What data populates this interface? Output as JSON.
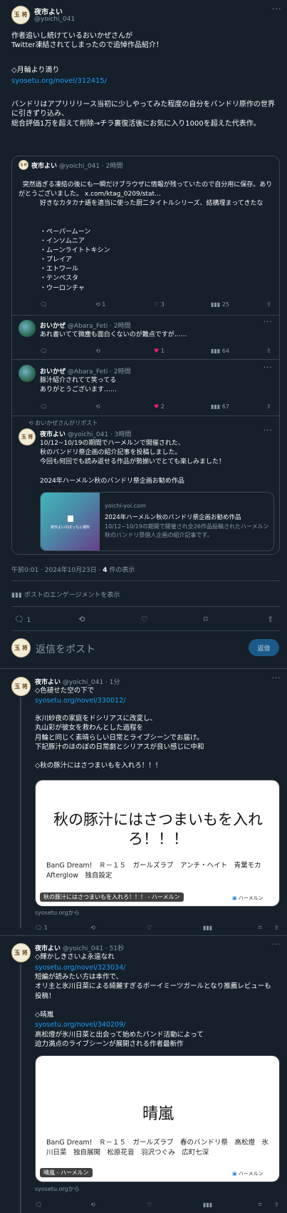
{
  "main": {
    "name": "夜市よい",
    "handle": "@yoichi_041",
    "avatar_text": "玉\n将",
    "body1": "作者追いし続けているおいかぜさんが\nTwitter凍結されてしまったので追悼作品紹介！",
    "heading1": "◇月輪より滴り",
    "link1": "syosetu.org/novel/312415/",
    "body2": "バンドリはアプリリリース当初に少しやってみた程度の自分をバンドリ原作の世界に引きずり込み、\n総合評価1万を超えて削除→チラ裏復活後にお気に入り1000を超えた代表作。",
    "timestamp": "午前0:01 · 2024年10月23日 · ",
    "views_count": "4",
    "views_label": " 件の表示",
    "engagement": "ポストのエンゲージメントを表示",
    "reply_count": "1"
  },
  "quote": {
    "name": "夜市よい",
    "handle": "@yoichi_041",
    "time": "· 2時間",
    "text": "突然過ぎる凍結の後にも一瞬だけブラウザに情報が残っていたので自分用に保存。ありがとうございました。",
    "link": "x.com/ktag_0209/stat…",
    "list_intro": "好きなカタカナ語を適当に使った厨二タイトルシリーズ、結構埋まってきたな",
    "list": [
      "・ペーパームーン",
      "・インソムニア",
      "・ムーンライトトキシン",
      "・プレイア",
      "・エトワール",
      "・テンペスタ",
      "・ウーロンチャ"
    ],
    "retweets": "1",
    "likes": "3",
    "views": "25"
  },
  "replies": [
    {
      "name": "おいかぜ",
      "handle": "@Abara_Feti",
      "time": "· 2時間",
      "text": "あれ書いてて微塵も面白くないのが難点ですが……",
      "likes": "1",
      "views": "64"
    },
    {
      "name": "おいかぜ",
      "handle": "@Abara_Feti",
      "time": "· 2時間",
      "text": "豚汁紹介されてて笑ってる\nありがとうございます……",
      "likes": "2",
      "views": "67"
    }
  ],
  "repost": {
    "label": "おいかぜさんがリポスト",
    "name": "夜市よい",
    "handle": "@yoichi_041",
    "time": "· 3時間",
    "text": "10/12~10/19の期間でハーメルンで開催された、\n秋のバンドリ祭企画の紹介記事を投稿しました。\n今回も何回でも読み返せる作品が勢揃いでとても楽しみました！\n\n2024年ハーメルン秋のバンドリ祭企画お勧め作品",
    "card_thumb": "夜市よいのぼっちん場所",
    "card_domain": "yoichi-yoi.com",
    "card_title": "2024年ハーメルン秋のバンドリ祭企画お勧め作品",
    "card_desc": "10/12~10/19の期間で開催され全26作品投稿されたハーメルン秋のバンドリ祭個人企画の紹介記事です。"
  },
  "reply_box": {
    "placeholder": "返信をポスト",
    "button": "返信"
  },
  "thread": [
    {
      "name": "夜市よい",
      "handle": "@yoichi_041",
      "time": "· 1分",
      "line1": "◇色褪せた空の下で",
      "link": "syosetu.org/novel/330012/",
      "text": "氷川紗夜の家庭をドシリアスに改変し、\n丸山彩が彼女を救わんとした過程を\n月輪と同じく素晴らしい日常とライブシーンでお届け。\n下記豚汁のほのぼの日常劇とシリアスが良い感じに中和\n\n◇秋の豚汁にはさつまいもを入れろ！！！",
      "card_title": "秋の豚汁にはさつまいもを入れろ！！！",
      "card_tags": "BanG Dream!　Ｒ－１５　ガールズラブ　アンチ・ヘイト　青葉モカ　Afterglow　独自設定",
      "card_badge": "秋の豚汁にはさつまいもを入れろ！！！ - ハーメルン",
      "card_site": "ハーメルン",
      "from": "syosetu.orgから",
      "reply_count": "1"
    },
    {
      "name": "夜市よい",
      "handle": "@yoichi_041",
      "time": "· 51秒",
      "line1": "◇輝かしきさいよ永遠なれ",
      "link": "syosetu.org/novel/323034/",
      "text": "短編が読みたい方は本作で、\nオリ主と氷川日菜による綺麗すぎるボーイミーツガールとなり推薦レビューも投稿！\n\n◇晴嵐",
      "link2": "syosetu.org/novel/340209/",
      "text2": "高松燈が氷川日菜と出会って始めたバンド活動によって\n迫力満点のライブシーンが展開される作者最新作",
      "card_title": "晴嵐",
      "card_tags": "BanG Dream!　Ｒ－１５　ガールズラブ　春のバンドリ祭　高松燈　氷川日菜　独自展開　松原花音　羽沢つぐみ　広町七深",
      "card_badge": "晴嵐 - ハーメルン",
      "card_site": "ハーメルン",
      "from": "syosetu.orgから"
    }
  ]
}
